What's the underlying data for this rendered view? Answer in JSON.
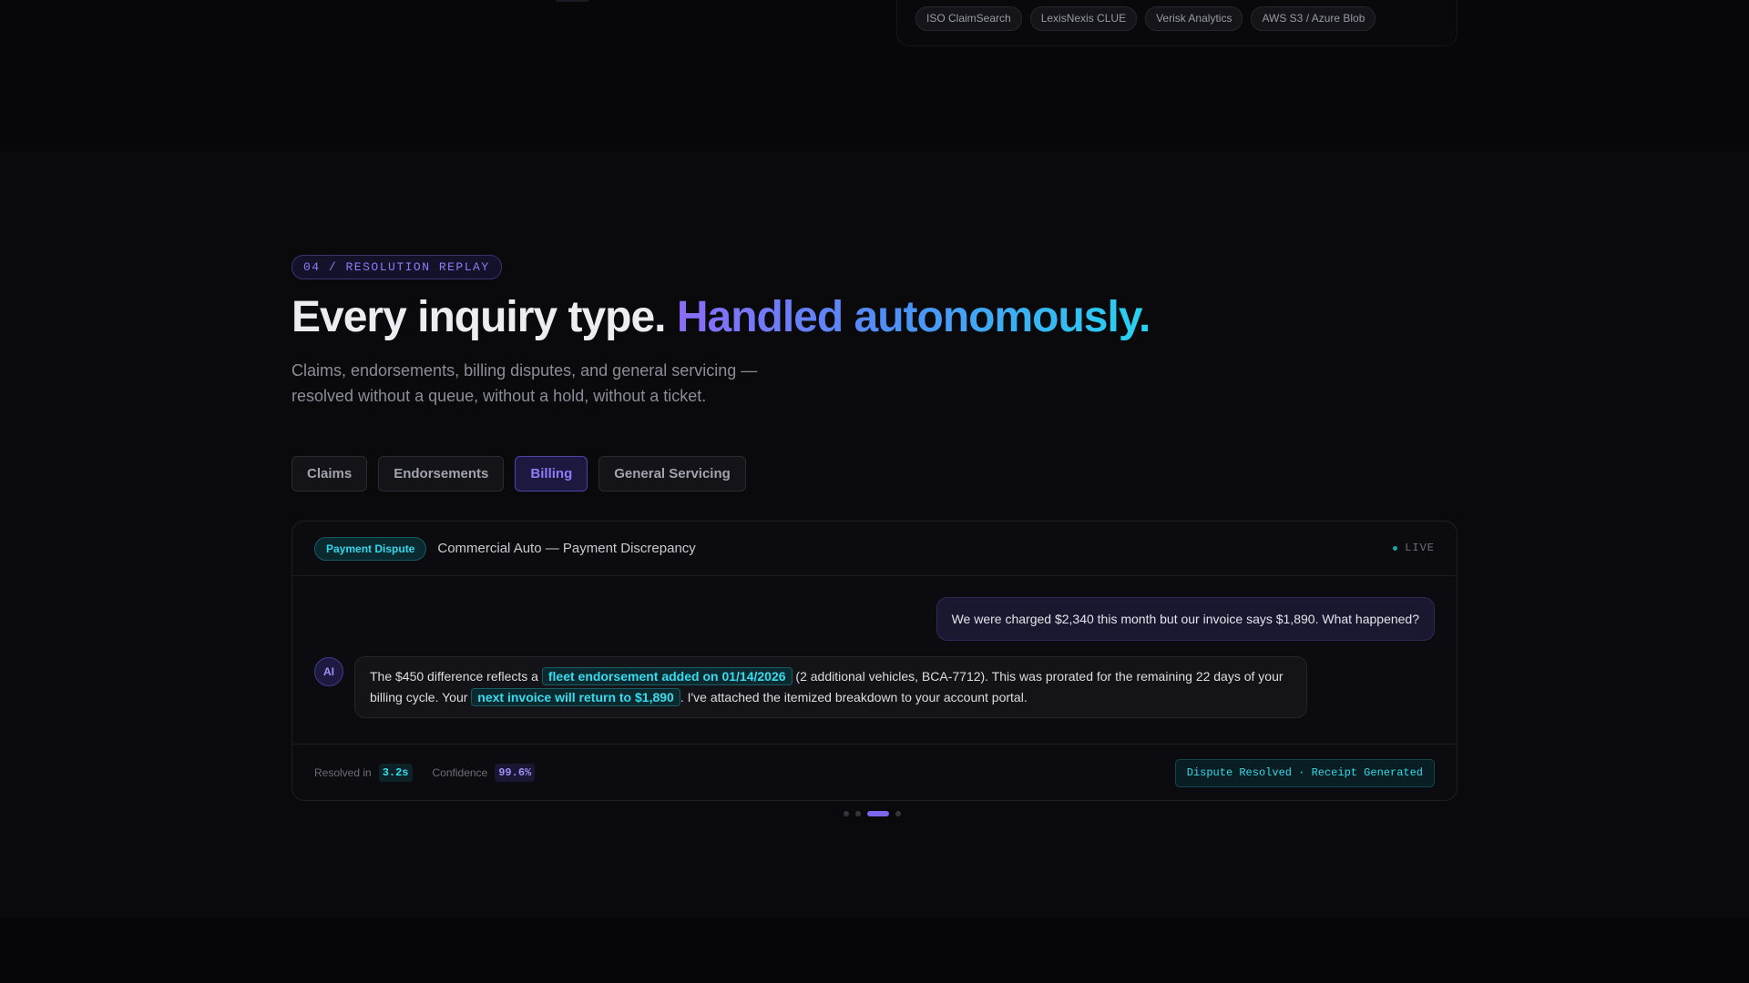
{
  "integrations": [
    "ISO ClaimSearch",
    "LexisNexis CLUE",
    "Verisk Analytics",
    "AWS S3 / Azure Blob"
  ],
  "section": {
    "eyebrow": "04 / RESOLUTION REPLAY",
    "headline_plain": "Every inquiry type. ",
    "headline_gradient": "Handled autonomously.",
    "subtitle": "Claims, endorsements, billing disputes, and general servicing — resolved without a queue, without a hold, without a ticket."
  },
  "tabs": [
    {
      "label": "Claims",
      "active": false
    },
    {
      "label": "Endorsements",
      "active": false
    },
    {
      "label": "Billing",
      "active": true
    },
    {
      "label": "General Servicing",
      "active": false
    }
  ],
  "panel": {
    "badge": "Payment Dispute",
    "case_title": "Commercial Auto — Payment Discrepancy",
    "live": "LIVE",
    "user_message": "We were charged $2,340 this month but our invoice says $1,890. What happened?",
    "ai_avatar": "AI",
    "ai_message": {
      "part1": "The $450 difference reflects a ",
      "highlight1": "fleet endorsement added on 01/14/2026",
      "part2": " (2 additional vehicles, BCA-7712). This was prorated for the remaining 22 days of your billing cycle. Your ",
      "highlight2": "next invoice will return to $1,890",
      "part3": ". I've attached the itemized breakdown to your account portal."
    },
    "footer": {
      "resolved_label": "Resolved in",
      "resolved_value": "3.2s",
      "confidence_label": "Confidence",
      "confidence_value": "99.6%",
      "status": "Dispute Resolved · Receipt Generated"
    }
  },
  "carousel": {
    "count": 4,
    "active_index": 2
  },
  "colors": {
    "accent_violet": "#8b7cf6",
    "accent_cyan": "#34d8ea",
    "background": "#0a0a0d"
  }
}
